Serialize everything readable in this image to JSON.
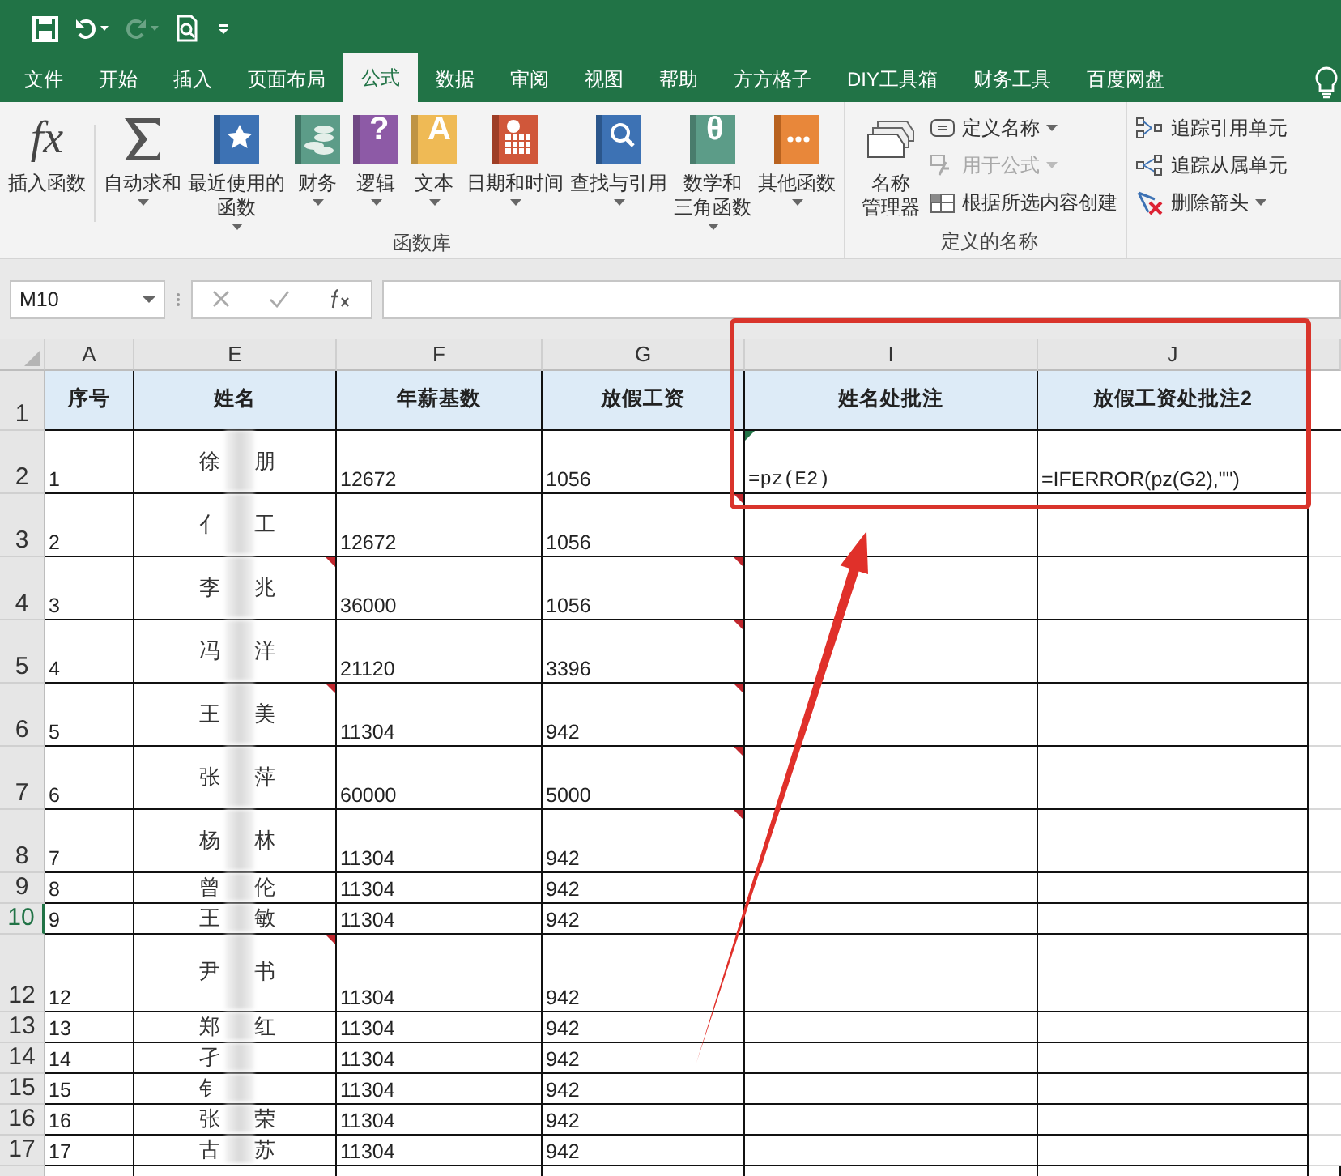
{
  "quick_access": {
    "undo_enabled": true,
    "redo_enabled": false
  },
  "tabs": [
    {
      "label": "文件",
      "selected": false
    },
    {
      "label": "开始",
      "selected": false
    },
    {
      "label": "插入",
      "selected": false
    },
    {
      "label": "页面布局",
      "selected": false
    },
    {
      "label": "公式",
      "selected": true
    },
    {
      "label": "数据",
      "selected": false
    },
    {
      "label": "审阅",
      "selected": false
    },
    {
      "label": "视图",
      "selected": false
    },
    {
      "label": "帮助",
      "selected": false
    },
    {
      "label": "方方格子",
      "selected": false
    },
    {
      "label": "DIY工具箱",
      "selected": false
    },
    {
      "label": "财务工具",
      "selected": false
    },
    {
      "label": "百度网盘",
      "selected": false
    }
  ],
  "ribbon": {
    "function_library": {
      "label": "函数库",
      "buttons": [
        {
          "kind": "fx",
          "glyph": "fx",
          "lines": [
            "插入函数"
          ],
          "dropdown": false
        },
        {
          "kind": "sigma",
          "lines": [
            "自动求和"
          ],
          "dropdown": true
        },
        {
          "kind": "star",
          "color": "#3d72b4",
          "lines": [
            "最近使用的",
            "函数"
          ],
          "dropdown": true
        },
        {
          "kind": "coins",
          "color": "#5c9c88",
          "lines": [
            "财务"
          ],
          "dropdown": true
        },
        {
          "kind": "book",
          "color": "#8d5aa6",
          "glyph": "?",
          "lines": [
            "逻辑"
          ],
          "dropdown": true
        },
        {
          "kind": "book",
          "color": "#efba55",
          "glyph": "A",
          "lines": [
            "文本"
          ],
          "dropdown": true
        },
        {
          "kind": "calendar",
          "color": "#d0573a",
          "lines": [
            "日期和时间"
          ],
          "dropdown": true
        },
        {
          "kind": "lookup",
          "color": "#3d72b4",
          "lines": [
            "查找与引用"
          ],
          "dropdown": true
        },
        {
          "kind": "book",
          "color": "#5c9c88",
          "glyph": "θ",
          "lines": [
            "数学和",
            "三角函数"
          ],
          "dropdown": true
        },
        {
          "kind": "more",
          "color": "#e8873a",
          "lines": [
            "其他函数"
          ],
          "dropdown": true
        }
      ]
    },
    "defined_names": {
      "label": "定义的名称",
      "big_button": [
        "名称",
        "管理器"
      ],
      "items": [
        {
          "kind": "tag",
          "label": "定义名称",
          "dropdown": true,
          "disabled": false
        },
        {
          "kind": "use",
          "label": "用于公式",
          "dropdown": true,
          "disabled": true
        },
        {
          "kind": "create",
          "label": "根据所选内容创建",
          "dropdown": false,
          "disabled": false
        }
      ]
    },
    "auditing": {
      "items": [
        {
          "kind": "precedents",
          "label": "追踪引用单元",
          "dropdown": false
        },
        {
          "kind": "dependents",
          "label": "追踪从属单元",
          "dropdown": false
        },
        {
          "kind": "remove",
          "label": "删除箭头",
          "dropdown": true
        }
      ]
    }
  },
  "formula_bar": {
    "name_box": "M10"
  },
  "columns": [
    "A",
    "E",
    "F",
    "G",
    "I",
    "J"
  ],
  "header_row": {
    "number": "1",
    "cells": [
      "序号",
      "姓名",
      "年薪基数",
      "放假工资",
      "姓名处批注",
      "放假工资处批注2"
    ]
  },
  "rows": [
    {
      "number": "2",
      "kind": "tall",
      "selected": false,
      "no": "1",
      "name_first": "徐",
      "name_last": "朋",
      "salary": "12672",
      "holiday": "1056",
      "comment_i": "=pz(E2)",
      "comment_j": "=IFERROR(pz(G2),\"\")",
      "e_note": false,
      "g_note": false,
      "i_error": true
    },
    {
      "number": "3",
      "kind": "tall",
      "selected": false,
      "no": "2",
      "name_first": "亻",
      "name_last": "工",
      "salary": "12672",
      "holiday": "1056",
      "e_note": false,
      "g_note": true,
      "i_error": false
    },
    {
      "number": "4",
      "kind": "tall",
      "selected": false,
      "no": "3",
      "name_first": "李",
      "name_last": "兆",
      "salary": "36000",
      "holiday": "1056",
      "e_note": true,
      "g_note": true,
      "i_error": false
    },
    {
      "number": "5",
      "kind": "tall",
      "selected": false,
      "no": "4",
      "name_first": "冯",
      "name_last": "洋",
      "salary": "21120",
      "holiday": "3396",
      "e_note": false,
      "g_note": true,
      "i_error": false
    },
    {
      "number": "6",
      "kind": "tall",
      "selected": false,
      "no": "5",
      "name_first": "王",
      "name_last": "美",
      "salary": "11304",
      "holiday": "942",
      "e_note": true,
      "g_note": true,
      "i_error": false
    },
    {
      "number": "7",
      "kind": "tall",
      "selected": false,
      "no": "6",
      "name_first": "张",
      "name_last": "萍",
      "salary": "60000",
      "holiday": "5000",
      "e_note": false,
      "g_note": true,
      "i_error": false
    },
    {
      "number": "8",
      "kind": "tall",
      "selected": false,
      "no": "7",
      "name_first": "杨",
      "name_last": "林",
      "salary": "11304",
      "holiday": "942",
      "e_note": false,
      "g_note": true,
      "i_error": false
    },
    {
      "number": "9",
      "kind": "short",
      "selected": false,
      "no": "8",
      "name_first": "曾",
      "name_last": "伦",
      "salary": "11304",
      "holiday": "942",
      "e_note": false,
      "g_note": false,
      "i_error": false
    },
    {
      "number": "10",
      "kind": "short",
      "selected": true,
      "no": "9",
      "name_first": "王",
      "name_last": "敏",
      "salary": "11304",
      "holiday": "942",
      "e_note": false,
      "g_note": false,
      "i_error": false
    },
    {
      "number": "12",
      "kind": "extra",
      "selected": false,
      "no": "12",
      "name_first": "尹",
      "name_last": "书",
      "salary": "11304",
      "holiday": "942",
      "e_note": true,
      "g_note": false,
      "i_error": false
    },
    {
      "number": "13",
      "kind": "short",
      "selected": false,
      "no": "13",
      "name_first": "郑",
      "name_last": "红",
      "salary": "11304",
      "holiday": "942",
      "e_note": false,
      "g_note": false,
      "i_error": false
    },
    {
      "number": "14",
      "kind": "short",
      "selected": false,
      "no": "14",
      "name_first": "孑",
      "salary": "11304",
      "holiday": "942",
      "e_note": false,
      "g_note": false,
      "i_error": false
    },
    {
      "number": "15",
      "kind": "short",
      "selected": false,
      "no": "15",
      "name_first": "钅",
      "salary": "11304",
      "holiday": "942",
      "e_note": false,
      "g_note": false,
      "i_error": false
    },
    {
      "number": "16",
      "kind": "short",
      "selected": false,
      "no": "16",
      "name_first": "张",
      "name_last": "荣",
      "salary": "11304",
      "holiday": "942",
      "e_note": false,
      "g_note": false,
      "i_error": false
    },
    {
      "number": "17",
      "kind": "short",
      "selected": false,
      "no": "17",
      "name_first": "古",
      "name_last": "苏",
      "salary": "11304",
      "holiday": "942",
      "e_note": false,
      "g_note": false,
      "i_error": false
    }
  ]
}
